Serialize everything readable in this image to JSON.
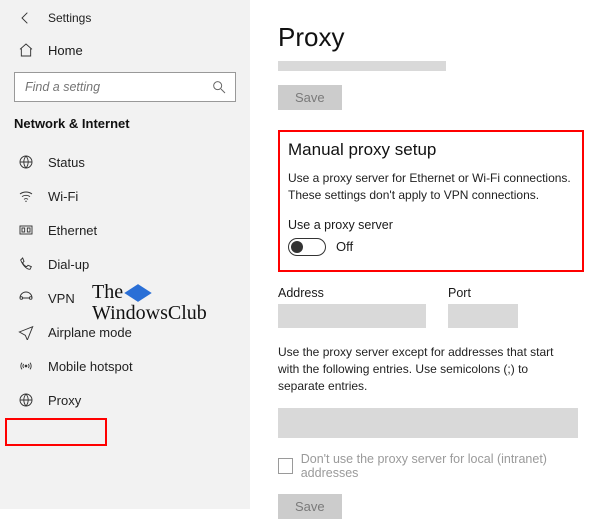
{
  "header": {
    "settings_label": "Settings"
  },
  "sidebar": {
    "home_label": "Home",
    "search_placeholder": "Find a setting",
    "section_title": "Network & Internet",
    "items": [
      {
        "label": "Status"
      },
      {
        "label": "Wi-Fi"
      },
      {
        "label": "Ethernet"
      },
      {
        "label": "Dial-up"
      },
      {
        "label": "VPN"
      },
      {
        "label": "Airplane mode"
      },
      {
        "label": "Mobile hotspot"
      },
      {
        "label": "Proxy"
      }
    ]
  },
  "main": {
    "title": "Proxy",
    "save_label_top": "Save",
    "manual": {
      "heading": "Manual proxy setup",
      "desc": "Use a proxy server for Ethernet or Wi-Fi connections. These settings don't apply to VPN connections.",
      "use_proxy_label": "Use a proxy server",
      "toggle_state": "Off"
    },
    "address_label": "Address",
    "port_label": "Port",
    "exceptions_desc": "Use the proxy server except for addresses that start with the following entries. Use semicolons (;) to separate entries.",
    "intranet_label": "Don't use the proxy server for local (intranet) addresses",
    "save_label_bottom": "Save"
  },
  "watermark": {
    "line1": "The",
    "line2": "WindowsClub"
  }
}
